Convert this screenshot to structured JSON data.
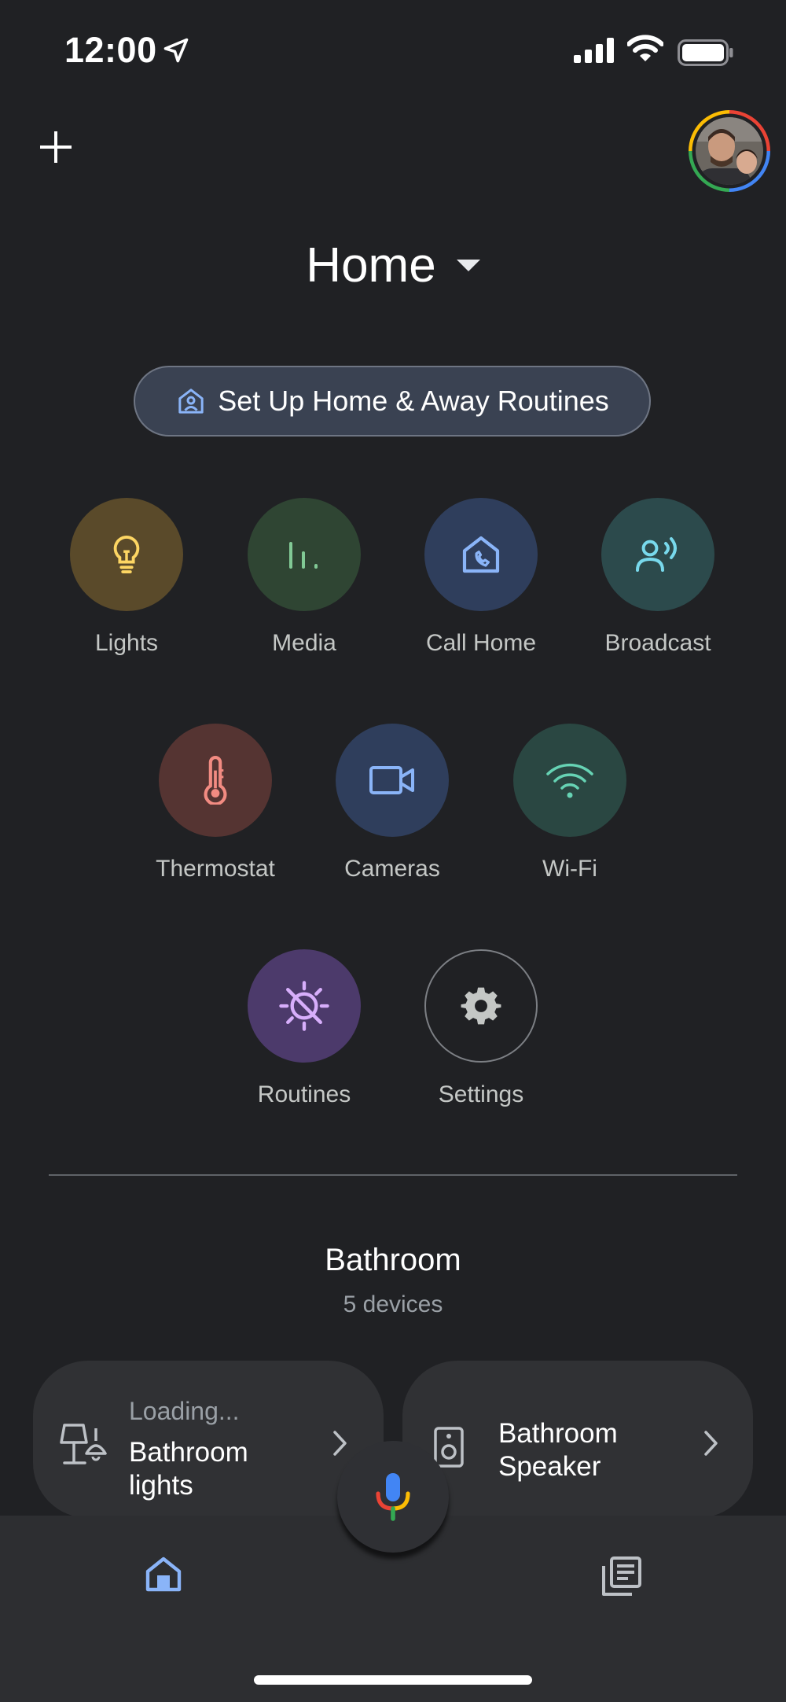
{
  "status_bar": {
    "time": "12:00"
  },
  "header": {
    "title": "Home"
  },
  "setup_banner": {
    "label": "Set Up Home & Away Routines"
  },
  "actions": [
    {
      "label": "Lights",
      "icon": "lightbulb-icon",
      "bg": "#5a4a2a",
      "fg": "#fdd663"
    },
    {
      "label": "Media",
      "icon": "media-bars-icon",
      "bg": "#2f4533",
      "fg": "#81c995"
    },
    {
      "label": "Call Home",
      "icon": "call-home-icon",
      "bg": "#2f3e5c",
      "fg": "#8ab4f8"
    },
    {
      "label": "Broadcast",
      "icon": "broadcast-icon",
      "bg": "#2c4a4c",
      "fg": "#78d9ec"
    },
    {
      "label": "Thermostat",
      "icon": "thermometer-icon",
      "bg": "#553432",
      "fg": "#f28b82"
    },
    {
      "label": "Cameras",
      "icon": "video-camera-icon",
      "bg": "#2f3e5c",
      "fg": "#8ab4f8"
    },
    {
      "label": "Wi-Fi",
      "icon": "wifi-icon",
      "bg": "#2a4742",
      "fg": "#66d3b4"
    },
    {
      "label": "Routines",
      "icon": "routines-icon",
      "bg": "#4c3a6b",
      "fg": "#d7aefb"
    },
    {
      "label": "Settings",
      "icon": "gear-icon",
      "bg": "transparent",
      "fg": "#c4c7c5"
    }
  ],
  "room": {
    "name": "Bathroom",
    "device_count": "5 devices",
    "devices": [
      {
        "status": "Loading...",
        "name_line1": "Bathroom",
        "name_line2": "lights",
        "icon": "lamp-icon"
      },
      {
        "name_line1": "Bathroom",
        "name_line2": "Speaker",
        "icon": "speaker-icon"
      }
    ]
  },
  "colors": {
    "background": "#202124",
    "accent": "#8ab4f8"
  }
}
